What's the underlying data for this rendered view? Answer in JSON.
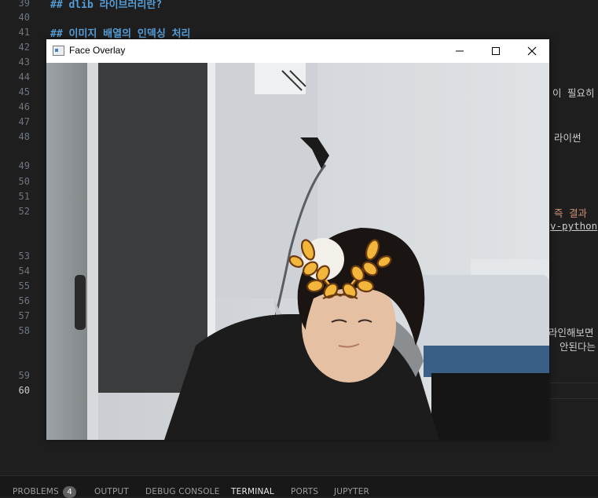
{
  "editor": {
    "line_numbers": [
      "39",
      "40",
      "41",
      "42",
      "43",
      "44",
      "45",
      "46",
      "47",
      "48",
      "49",
      "50",
      "51",
      "52",
      "53",
      "54",
      "55",
      "56",
      "57",
      "58",
      "59",
      "60"
    ],
    "active_line": "60",
    "headings": [
      "## dlib 라이브러리란?",
      "## 이미지 배열의 인덱싱 처리"
    ],
    "visible_fragments": [
      "이 필요히",
      "라이썬",
      "즉 결과",
      "v-python",
      "라인해보면",
      "안된다는"
    ]
  },
  "window": {
    "title": "Face Overlay",
    "buttons": {
      "minimize": "minimize",
      "maximize": "maximize",
      "close": "close"
    }
  },
  "panel": {
    "tabs": [
      "PROBLEMS",
      "OUTPUT",
      "DEBUG CONSOLE",
      "TERMINAL",
      "PORTS",
      "JUPYTER"
    ],
    "problems_count": "4",
    "active_tab": "TERMINAL"
  },
  "colors": {
    "heading": "#569cd6",
    "editor_bg": "#1e1e1e",
    "overlay_gold": "#f2b63a"
  }
}
